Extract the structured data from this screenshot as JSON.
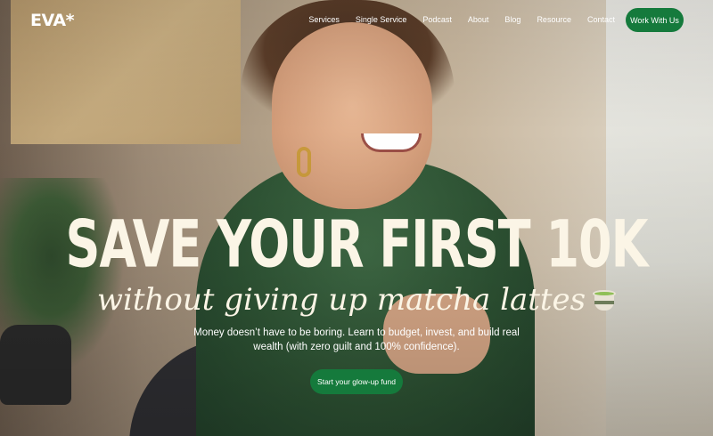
{
  "brand": {
    "logo": "EVA*"
  },
  "nav": {
    "items": [
      "Services",
      "Single Service",
      "Podcast",
      "About",
      "Blog",
      "Resource",
      "Contact"
    ],
    "cta": "Work With Us"
  },
  "hero": {
    "headline": "SAVE YOUR FIRST 10K",
    "subheadline": "without giving up matcha lattes",
    "subheadline_icon": "matcha-cup-icon",
    "body": "Money doesn’t have to be boring. Learn to budget, invest, and build real wealth (with zero guilt and 100% confidence).",
    "cta": "Start your glow-up fund"
  },
  "colors": {
    "accent": "#157a3c",
    "headline": "#fbf5e6"
  }
}
